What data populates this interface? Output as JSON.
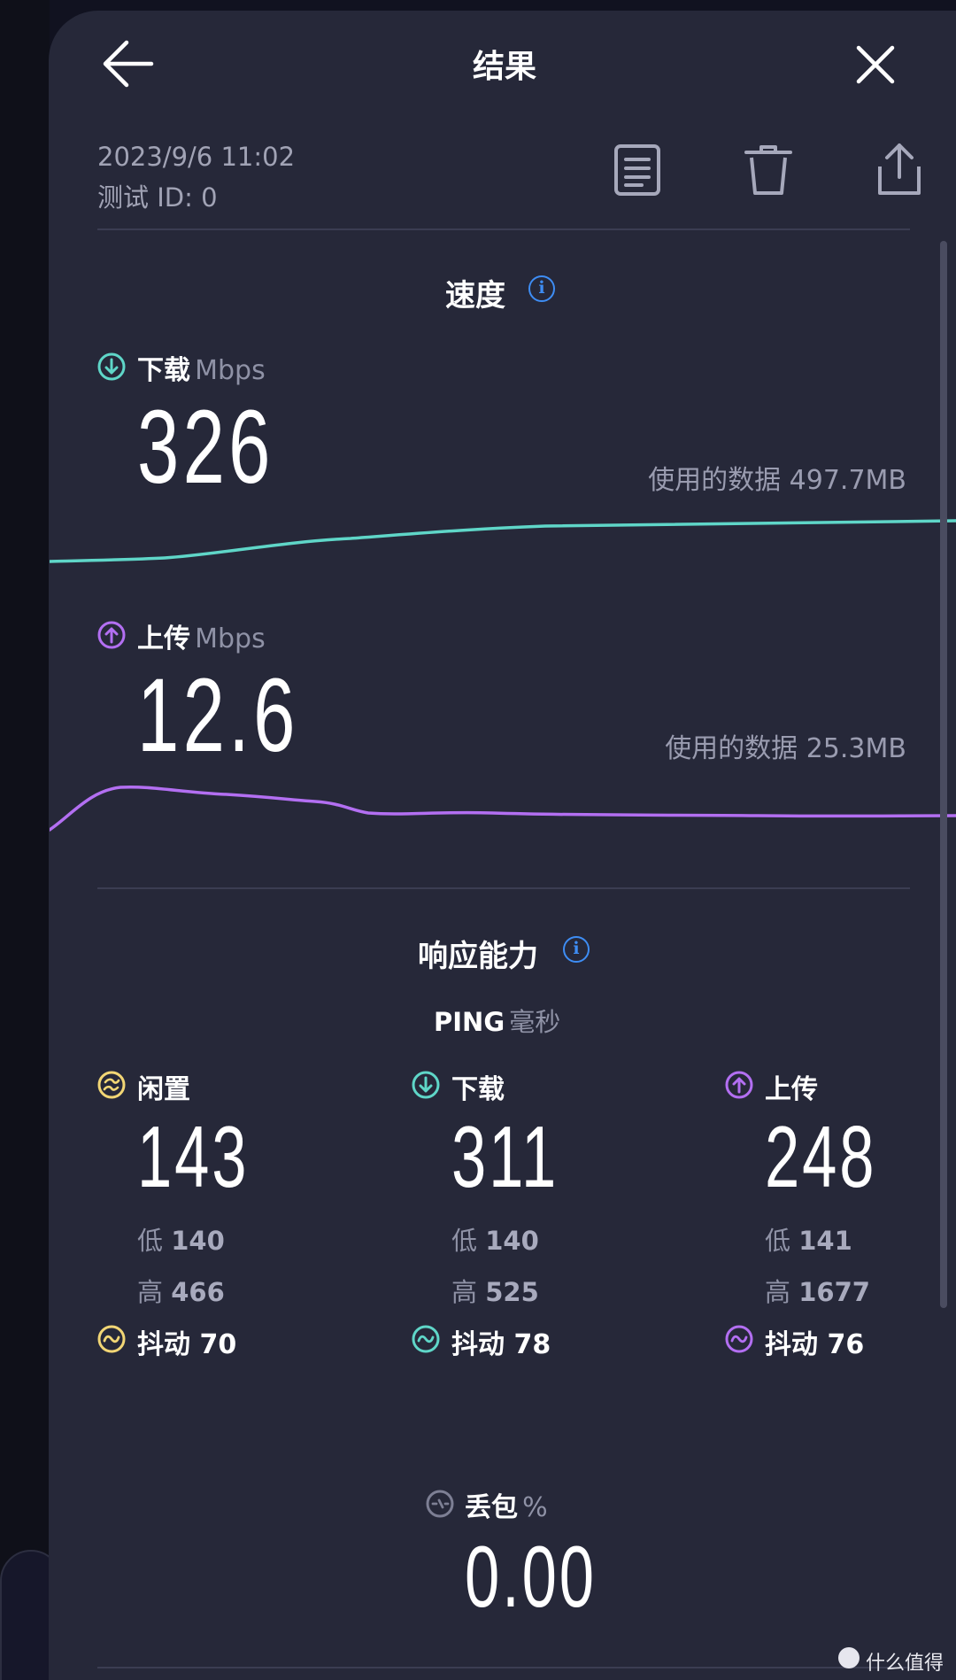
{
  "header": {
    "title": "结果",
    "back_icon": "arrow-left-icon",
    "close_icon": "close-icon"
  },
  "test_meta": {
    "datetime": "2023/9/6 11:02",
    "test_id": "测试 ID: 0"
  },
  "actions": {
    "report_icon": "document-icon",
    "delete_icon": "trash-icon",
    "share_icon": "share-icon"
  },
  "speed": {
    "title": "速度",
    "download": {
      "label": "下载",
      "unit": "Mbps",
      "value": "326",
      "data_used": "使用的数据 497.7MB",
      "color": "#5fd6c8"
    },
    "upload": {
      "label": "上传",
      "unit": "Mbps",
      "value": "12.6",
      "data_used": "使用的数据 25.3MB",
      "color": "#b36ff2"
    }
  },
  "responsiveness": {
    "title": "响应能力",
    "ping_label": "PING",
    "ping_unit": "毫秒",
    "idle": {
      "label": "闲置",
      "value": "143",
      "low_label": "低",
      "low": "140",
      "high_label": "高",
      "high": "466",
      "jitter_label": "抖动",
      "jitter": "70",
      "color": "#f2d675"
    },
    "download": {
      "label": "下载",
      "value": "311",
      "low_label": "低",
      "low": "140",
      "high_label": "高",
      "high": "525",
      "jitter_label": "抖动",
      "jitter": "78",
      "color": "#5fd6c8"
    },
    "upload": {
      "label": "上传",
      "value": "248",
      "low_label": "低",
      "low": "141",
      "high_label": "高",
      "high": "1677",
      "jitter_label": "抖动",
      "jitter": "76",
      "color": "#b36ff2"
    }
  },
  "packet_loss": {
    "label": "丢包",
    "unit": "%",
    "value": "0.00"
  },
  "watermark": "什么值得买"
}
